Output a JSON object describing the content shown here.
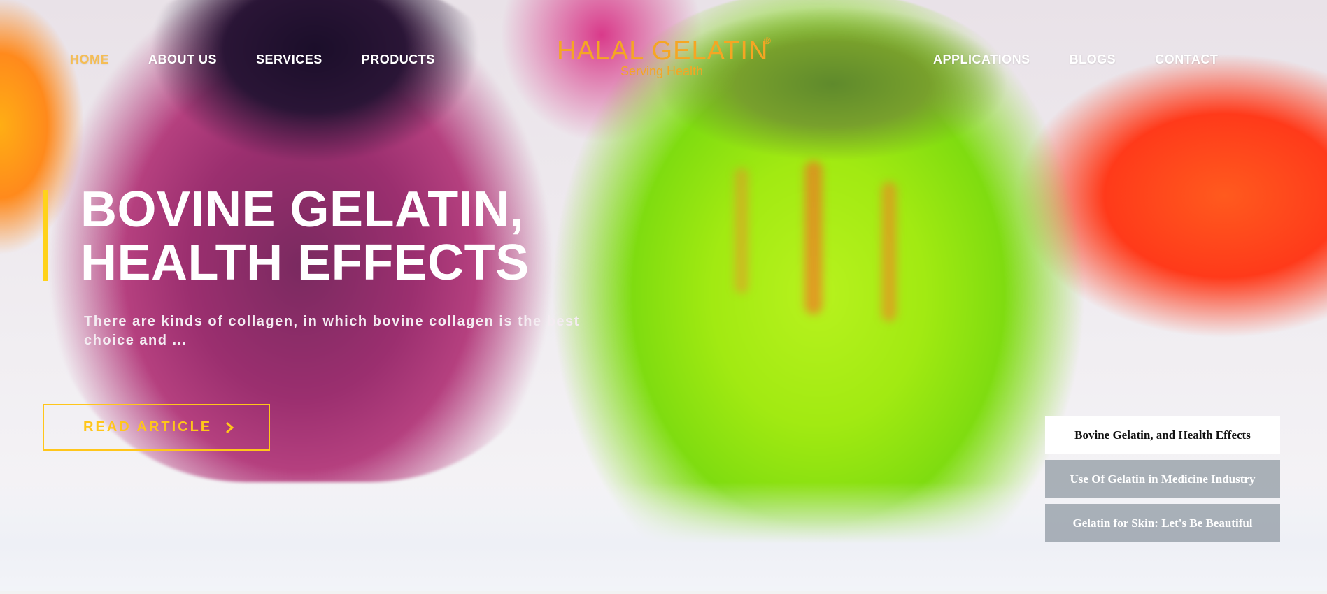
{
  "nav": {
    "left": [
      {
        "label": "HOME",
        "active": true
      },
      {
        "label": "ABOUT US",
        "active": false
      },
      {
        "label": "SERVICES",
        "active": false
      },
      {
        "label": "PRODUCTS",
        "active": false
      }
    ],
    "right": [
      {
        "label": "APPLICATIONS",
        "active": false
      },
      {
        "label": "BLOGS",
        "active": false
      },
      {
        "label": "CONTACT",
        "active": false
      }
    ]
  },
  "logo": {
    "word": "HALAL GELATIN",
    "registered": "®",
    "tagline": "Serving Health",
    "color": "#f5a623"
  },
  "hero": {
    "headline_line1": "BOVINE GELATIN,",
    "headline_line2": "HEALTH EFFECTS",
    "subtext": "There are kinds of collagen, in which bovine collagen is the best choice and ...",
    "button_label": "READ ARTICLE",
    "accent_color": "#ffd21a"
  },
  "slides": [
    {
      "label": "Bovine Gelatin, and Health Effects",
      "active": true
    },
    {
      "label": "Use Of Gelatin in Medicine Industry",
      "active": false
    },
    {
      "label": "Gelatin for Skin: Let's Be Beautiful",
      "active": false
    }
  ],
  "icons": {
    "button_arrow": "chevron-right-icon"
  }
}
